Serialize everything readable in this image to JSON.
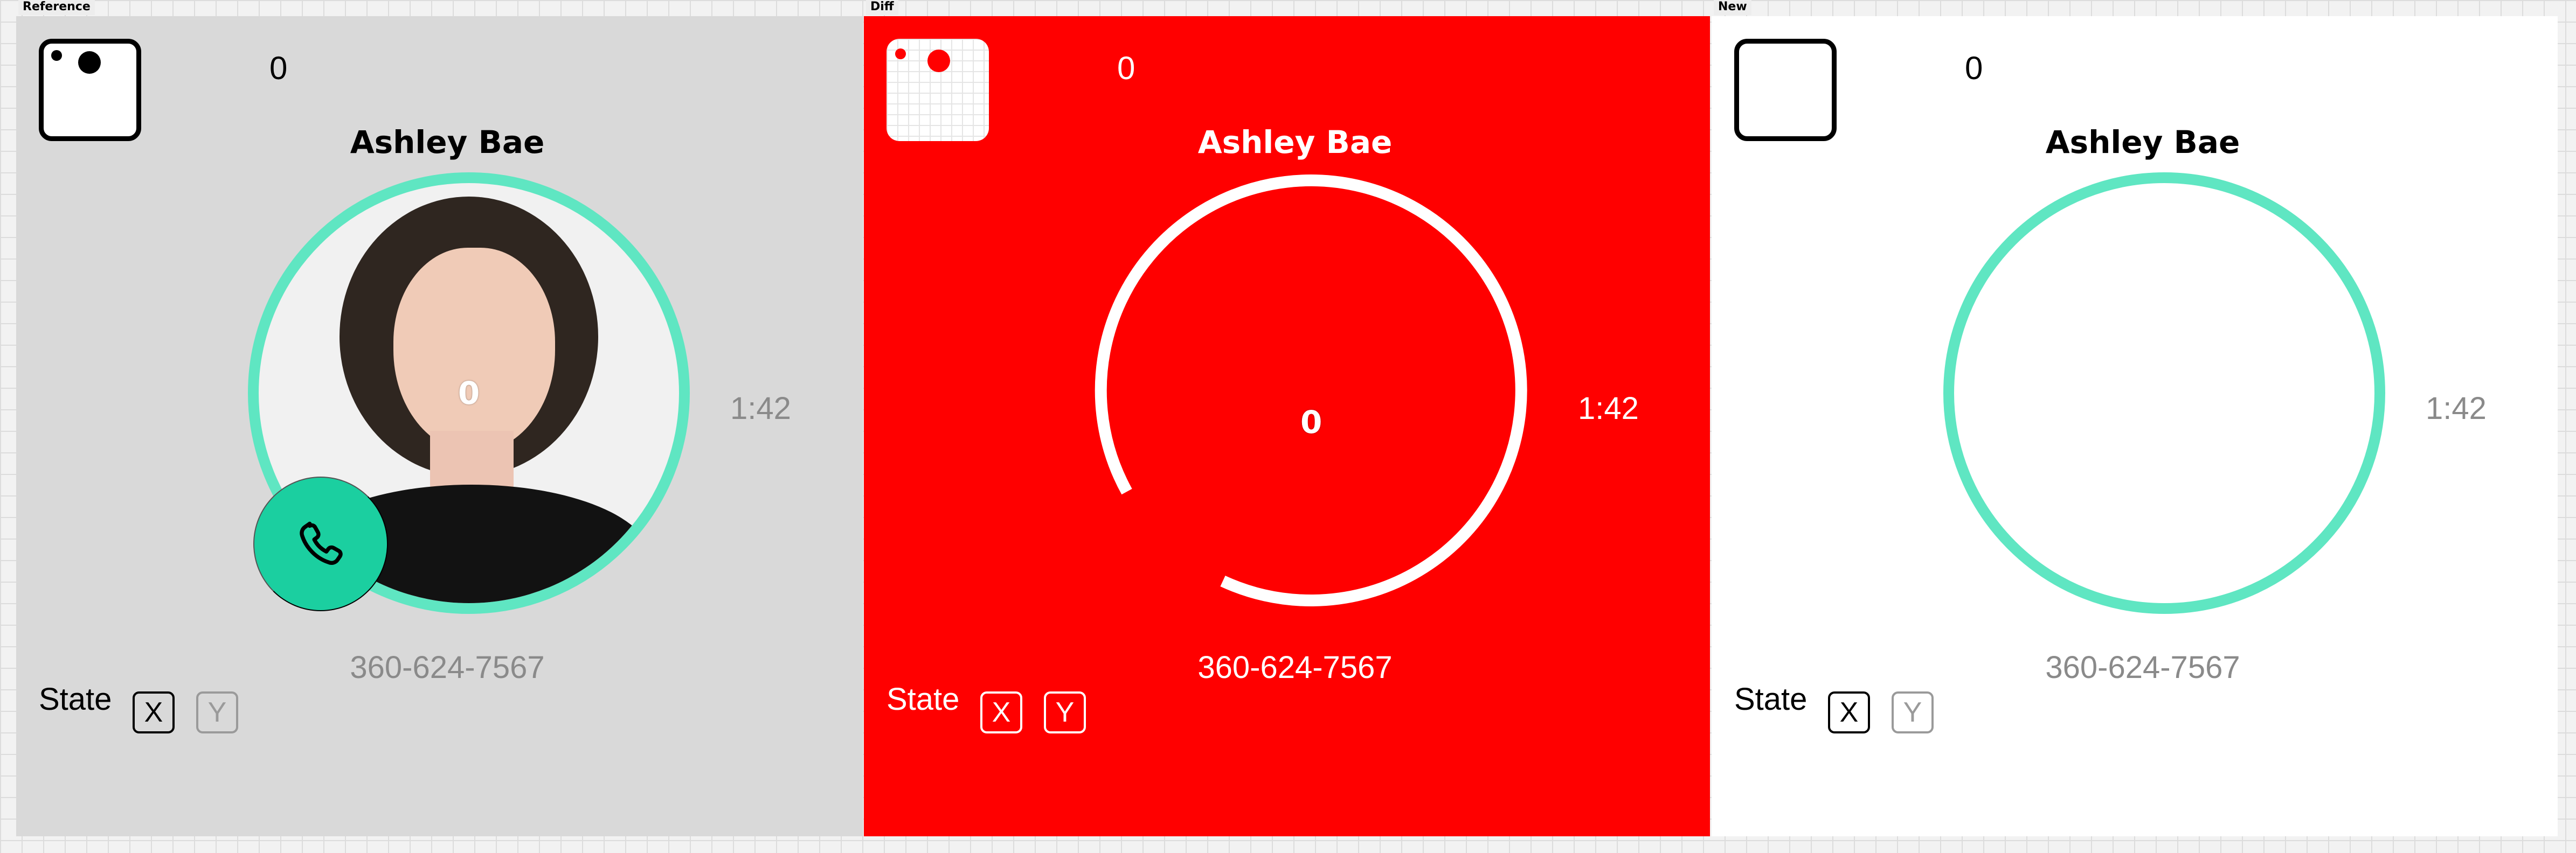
{
  "labels": {
    "reference": "Reference",
    "diff": "Diff",
    "new": "New"
  },
  "panels": {
    "reference": {
      "counter": "0",
      "contact_name": "Ashley Bae",
      "ring_label": "0",
      "call_time": "1:42",
      "phone_number": "360-624-7567",
      "state_label": "State",
      "state_x": "X",
      "state_y": "Y"
    },
    "diff": {
      "counter": "0",
      "contact_name": "Ashley Bae",
      "ring_label": "0",
      "call_time": "1:42",
      "phone_number": "360-624-7567",
      "state_label": "State",
      "state_x": "X",
      "state_y": "Y"
    },
    "new": {
      "counter": "0",
      "contact_name": "Ashley Bae",
      "call_time": "1:42",
      "phone_number": "360-624-7567",
      "state_label": "State",
      "state_x": "X",
      "state_y": "Y"
    }
  },
  "icons": {
    "call_button": "phone-icon"
  },
  "colors": {
    "ring": "#5fe6c2",
    "call_button": "#1bcfa0",
    "diff_background": "#ff0000"
  }
}
